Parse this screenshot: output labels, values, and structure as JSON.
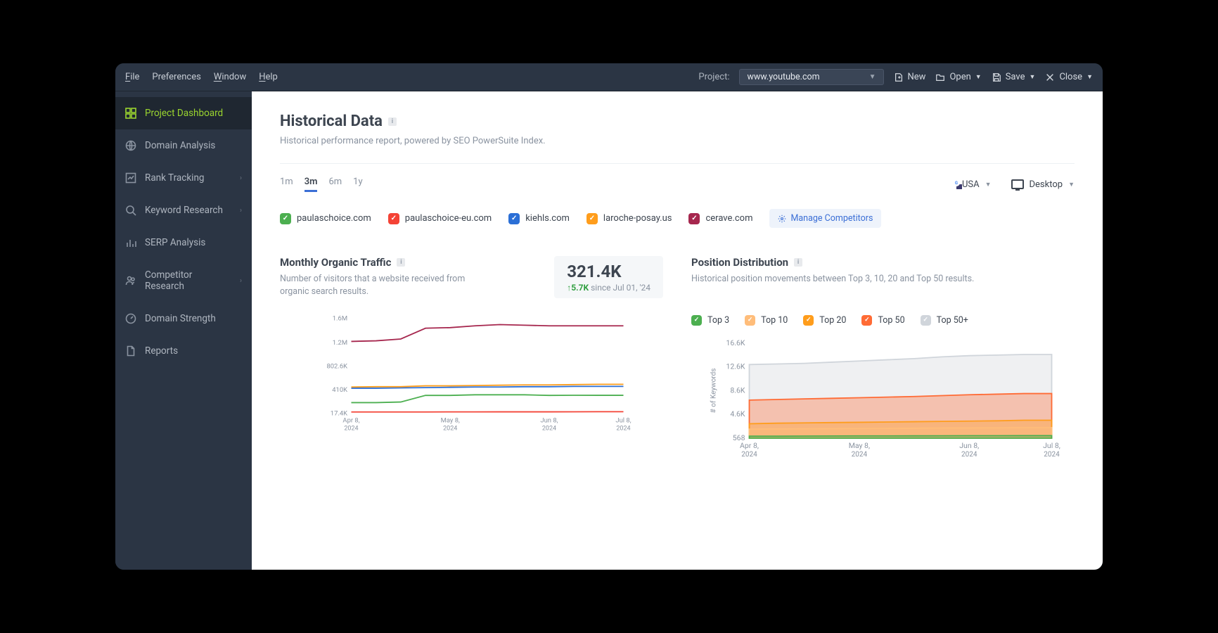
{
  "menubar": {
    "items": [
      "File",
      "Preferences",
      "Window",
      "Help"
    ],
    "project_label": "Project:",
    "project_value": "www.youtube.com",
    "actions": {
      "new": "New",
      "open": "Open",
      "save": "Save",
      "close": "Close"
    }
  },
  "sidebar": {
    "items": [
      {
        "label": "Project Dashboard",
        "icon": "dashboard",
        "active": true
      },
      {
        "label": "Domain Analysis",
        "icon": "globe"
      },
      {
        "label": "Rank Tracking",
        "icon": "chart-line",
        "chevron": true
      },
      {
        "label": "Keyword Research",
        "icon": "search",
        "chevron": true
      },
      {
        "label": "SERP Analysis",
        "icon": "bars"
      },
      {
        "label": "Competitor Research",
        "icon": "people",
        "chevron": true
      },
      {
        "label": "Domain Strength",
        "icon": "gauge"
      },
      {
        "label": "Reports",
        "icon": "doc"
      }
    ]
  },
  "page": {
    "title": "Historical Data",
    "subtitle": "Historical performance report, powered by SEO PowerSuite Index."
  },
  "time_tabs": [
    "1m",
    "3m",
    "6m",
    "1y"
  ],
  "time_tab_active": "3m",
  "country": {
    "label": "USA"
  },
  "device": {
    "label": "Desktop"
  },
  "competitors": [
    {
      "label": "paulaschoice.com",
      "color": "#4caf50"
    },
    {
      "label": "paulaschoice-eu.com",
      "color": "#f44336"
    },
    {
      "label": "kiehls.com",
      "color": "#2b6fd6"
    },
    {
      "label": "laroche-posay.us",
      "color": "#ff9d1c"
    },
    {
      "label": "cerave.com",
      "color": "#a6274e"
    }
  ],
  "manage_competitors": "Manage Competitors",
  "traffic_chart": {
    "title": "Monthly Organic Traffic",
    "subtitle": "Number of visitors that a website received from organic search results.",
    "metric_value": "321.4K",
    "metric_delta": "5.7K",
    "metric_since": "since Jul 01, '24"
  },
  "position_chart": {
    "title": "Position Distribution",
    "subtitle": "Historical position movements between Top 3, 10, 20 and Top 50 results.",
    "y_axis_title": "# of Keywords",
    "legend": [
      {
        "label": "Top 3",
        "color": "#4caf50"
      },
      {
        "label": "Top 10",
        "color": "#ffbd7a"
      },
      {
        "label": "Top 20",
        "color": "#ff9d1c"
      },
      {
        "label": "Top 50",
        "color": "#ff6b35"
      },
      {
        "label": "Top 50+",
        "color": "#d0d5db"
      }
    ]
  },
  "chart_data": [
    {
      "type": "line",
      "title": "Monthly Organic Traffic",
      "xlabel": "",
      "ylabel": "",
      "y_ticks": [
        "1.6M",
        "1.2M",
        "802.6K",
        "410K",
        "17.4K"
      ],
      "x_ticks": [
        "Apr 8, 2024",
        "May 8, 2024",
        "Jun 8, 2024",
        "Jul 8, 2024"
      ],
      "ylim": [
        17400,
        1600000
      ],
      "series": [
        {
          "name": "paulaschoice.com",
          "color": "#4caf50",
          "values": [
            200000,
            200000,
            210000,
            320000,
            320000,
            330000,
            330000,
            330000,
            320000,
            322000,
            321400,
            321400
          ]
        },
        {
          "name": "paulaschoice-eu.com",
          "color": "#f44336",
          "values": [
            44000,
            44000,
            44000,
            44000,
            45000,
            45000,
            46000,
            46000,
            46000,
            47000,
            48000,
            48000
          ]
        },
        {
          "name": "kiehls.com",
          "color": "#2b6fd6",
          "values": [
            440000,
            440000,
            445000,
            450000,
            455000,
            460000,
            460000,
            465000,
            465000,
            470000,
            470000,
            470000
          ]
        },
        {
          "name": "laroche-posay.us",
          "color": "#ff9d1c",
          "values": [
            460000,
            465000,
            465000,
            480000,
            480000,
            485000,
            490000,
            495000,
            495000,
            500000,
            505000,
            505000
          ]
        },
        {
          "name": "cerave.com",
          "color": "#a6274e",
          "values": [
            1220000,
            1230000,
            1260000,
            1440000,
            1450000,
            1480000,
            1500000,
            1490000,
            1480000,
            1480000,
            1480000,
            1480000
          ]
        }
      ]
    },
    {
      "type": "area",
      "title": "Position Distribution",
      "xlabel": "",
      "ylabel": "# of Keywords",
      "y_ticks": [
        "16.6K",
        "12.6K",
        "8.6K",
        "4.6K",
        "568"
      ],
      "x_ticks": [
        "Apr 8, 2024",
        "May 8, 2024",
        "Jun 8, 2024",
        "Jul 8, 2024"
      ],
      "ylim": [
        568,
        16600
      ],
      "series": [
        {
          "name": "Top 3",
          "color": "#4caf50",
          "values": [
            900,
            900,
            920,
            940,
            950,
            950,
            960,
            970,
            980,
            980,
            990,
            990
          ]
        },
        {
          "name": "Top 10",
          "color": "#ffbd7a",
          "values": [
            2100,
            2120,
            2150,
            2180,
            2200,
            2220,
            2250,
            2280,
            2300,
            2320,
            2350,
            2350
          ]
        },
        {
          "name": "Top 20",
          "color": "#ff9d1c",
          "values": [
            3000,
            3100,
            3150,
            3200,
            3250,
            3300,
            3350,
            3400,
            3450,
            3500,
            3600,
            3600
          ]
        },
        {
          "name": "Top 50",
          "color": "#ff6b35",
          "values": [
            7000,
            7100,
            7200,
            7300,
            7400,
            7500,
            7600,
            7750,
            7900,
            8000,
            8100,
            8100
          ]
        },
        {
          "name": "Top 50+",
          "color": "#d0d5db",
          "values": [
            13000,
            13100,
            13200,
            13400,
            13600,
            13800,
            14000,
            14300,
            14500,
            14600,
            14700,
            14700
          ]
        }
      ]
    }
  ]
}
